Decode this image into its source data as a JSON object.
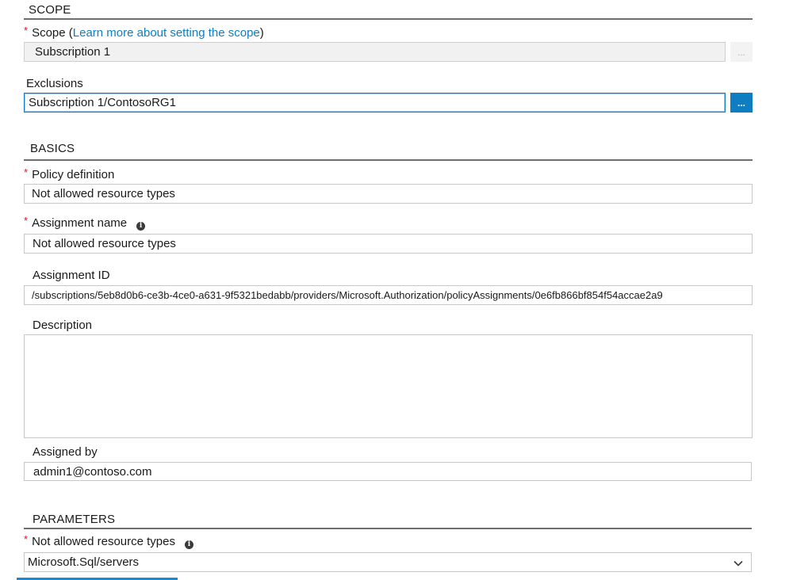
{
  "scope_section": {
    "title": "SCOPE",
    "scope_label_prefix": "Scope (",
    "scope_link": "Learn more about setting the scope",
    "scope_label_suffix": ")",
    "scope_value": "Subscription 1",
    "scope_button": "...",
    "exclusions_label": "Exclusions",
    "exclusions_value": "Subscription 1/ContosoRG1",
    "exclusions_button": "..."
  },
  "basics_section": {
    "title": "BASICS",
    "policy_definition_label": "Policy definition",
    "policy_definition_value": "Not allowed resource types",
    "assignment_name_label": "Assignment name",
    "assignment_name_value": "Not allowed resource types",
    "assignment_id_label": "Assignment ID",
    "assignment_id_value": "/subscriptions/5eb8d0b6-ce3b-4ce0-a631-9f5321bedabb/providers/Microsoft.Authorization/policyAssignments/0e6fb866bf854f54accae2a9",
    "description_label": "Description",
    "description_value": "",
    "assigned_by_label": "Assigned by",
    "assigned_by_value": "admin1@contoso.com"
  },
  "parameters_section": {
    "title": "PARAMETERS",
    "not_allowed_types_label": "Not allowed resource types",
    "not_allowed_types_value": "Microsoft.Sql/servers"
  },
  "info_icon_glyph": "i",
  "required_marker": "*",
  "colors": {
    "accent": "#0f7dc2",
    "required": "#e81123",
    "divider": "#6e6e6e"
  }
}
